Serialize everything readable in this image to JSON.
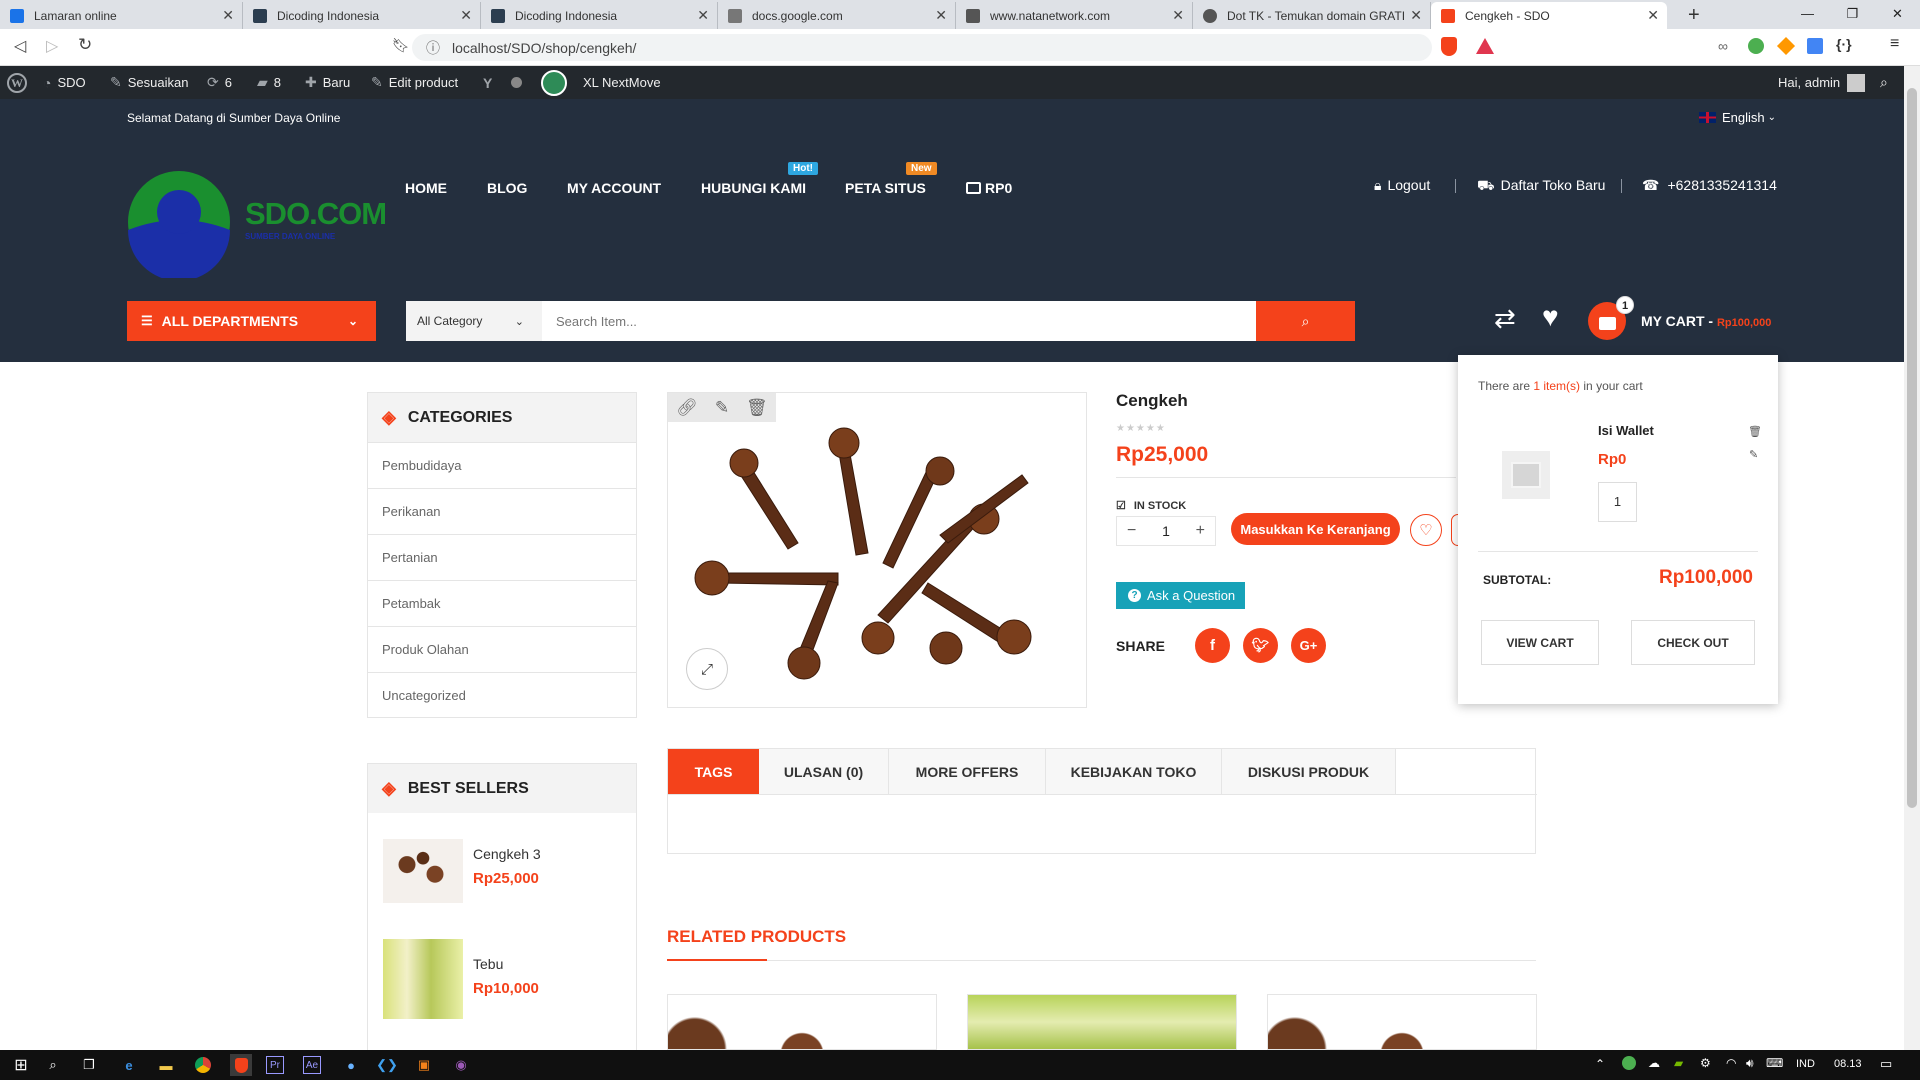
{
  "browser": {
    "tabs": [
      {
        "title": "Lamaran online",
        "color": "#1a73e8"
      },
      {
        "title": "Dicoding Indonesia",
        "color": "#2c3e50"
      },
      {
        "title": "Dicoding Indonesia",
        "color": "#2c3e50"
      },
      {
        "title": "docs.google.com",
        "color": "#777777"
      },
      {
        "title": "www.natanetwork.com",
        "color": "#555555"
      },
      {
        "title": "Dot TK - Temukan domain GRATIS",
        "color": "#555555"
      },
      {
        "title": "Cengkeh - SDO",
        "color": "#f4421b"
      }
    ],
    "url": "localhost/SDO/shop/cengkeh/"
  },
  "adminbar": {
    "site": "SDO",
    "customize": "Sesuaikan",
    "updates": "6",
    "comments": "8",
    "new": "Baru",
    "edit": "Edit product",
    "plugin": "XL NextMove",
    "greeting": "Hai, admin"
  },
  "topstrip": {
    "welcome": "Selamat Datang di Sumber Daya Online",
    "language": "English"
  },
  "logo": {
    "text": "SDO.COM",
    "tagline": "SUMBER DAYA ONLINE"
  },
  "nav": {
    "home": "HOME",
    "blog": "BLOG",
    "account": "MY ACCOUNT",
    "contact": "HUBUNGI KAMI",
    "contact_badge": "Hot!",
    "sitemap": "PETA SITUS",
    "sitemap_badge": "New",
    "wallet": "RP0"
  },
  "header_links": {
    "logout": "Logout",
    "register_store": "Daftar Toko Baru",
    "phone": "+6281335241314"
  },
  "departments": "ALL DEPARTMENTS",
  "search": {
    "category": "All Category",
    "placeholder": "Search Item..."
  },
  "cart": {
    "count": "1",
    "label": "MY CART -",
    "total": "Rp100,000",
    "dropdown": {
      "intro_before": "There are",
      "intro_count": "1 item(s)",
      "intro_after": "in your cart",
      "item_name": "Isi Wallet",
      "item_price": "Rp0",
      "item_qty": "1",
      "subtotal_label": "SUBTOTAL:",
      "subtotal_value": "Rp100,000",
      "view_cart": "VIEW CART",
      "checkout": "CHECK OUT"
    }
  },
  "categories": {
    "title": "CATEGORIES",
    "items": [
      "Pembudidaya",
      "Perikanan",
      "Pertanian",
      "Petambak",
      "Produk Olahan",
      "Uncategorized"
    ]
  },
  "best_sellers": {
    "title": "BEST SELLERS",
    "items": [
      {
        "name": "Cengkeh 3",
        "price": "Rp25,000"
      },
      {
        "name": "Tebu",
        "price": "Rp10,000"
      }
    ]
  },
  "product": {
    "name": "Cengkeh",
    "price": "Rp25,000",
    "stock": "IN STOCK",
    "qty": "1",
    "add_to_cart": "Masukkan Ke Keranjang",
    "ask": "Ask a Question",
    "share": "SHARE"
  },
  "product_tabs": [
    "TAGS",
    "ULASAN (0)",
    "MORE OFFERS",
    "KEBIJAKAN TOKO",
    "DISKUSI PRODUK"
  ],
  "related": {
    "title": "RELATED PRODUCTS"
  },
  "taskbar": {
    "lang": "IND",
    "time": "08.13"
  }
}
